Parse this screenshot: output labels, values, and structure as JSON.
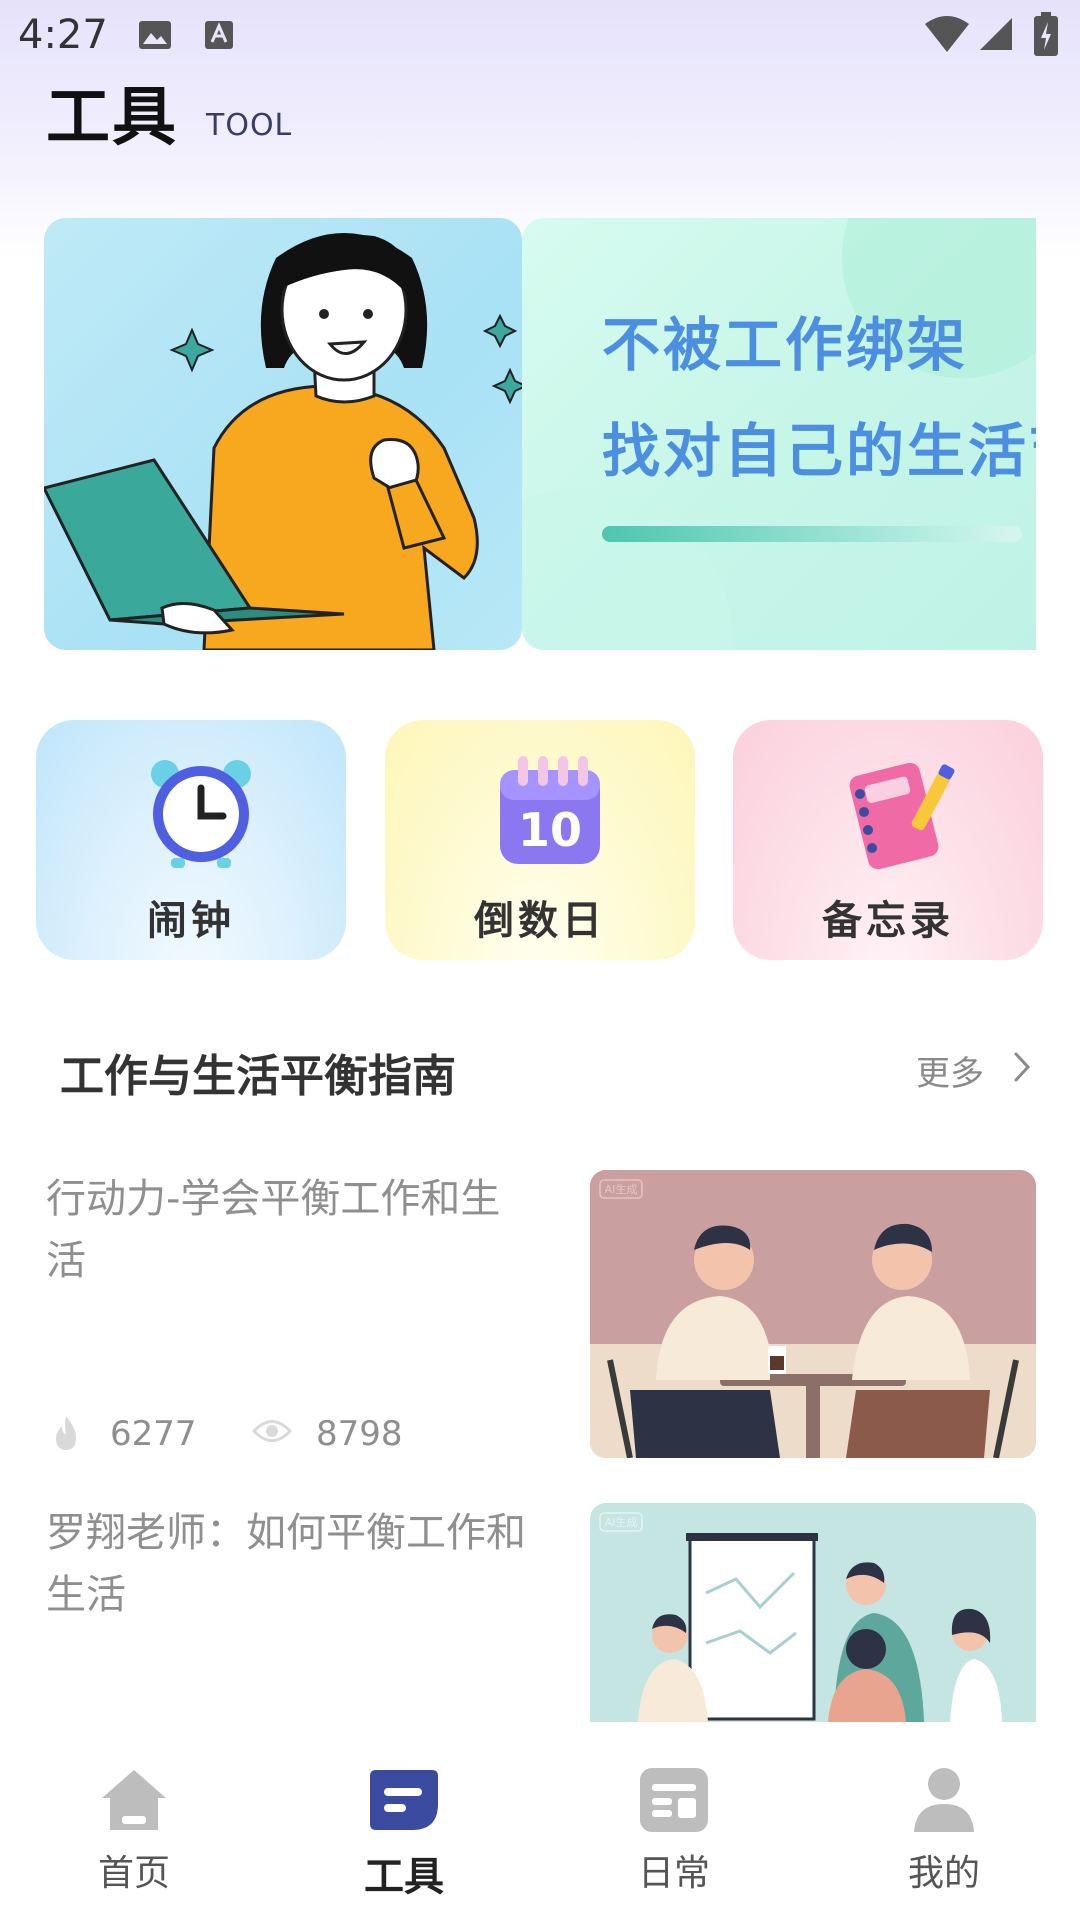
{
  "status_bar": {
    "time": "4:27"
  },
  "header": {
    "title": "工具",
    "subtitle": "TOOL"
  },
  "banner": {
    "line1": "不被工作绑架",
    "line2": "找对自己的生活节"
  },
  "tools": [
    {
      "label": "闹钟",
      "icon": "alarm-clock-icon"
    },
    {
      "label": "倒数日",
      "icon": "calendar-countdown-icon",
      "badge": "10"
    },
    {
      "label": "备忘录",
      "icon": "notebook-icon"
    }
  ],
  "section": {
    "title": "工作与生活平衡指南",
    "more": "更多"
  },
  "articles": [
    {
      "title": "行动力-学会平衡工作和生活",
      "likes": "6277",
      "views": "8798",
      "thumb_badge": "AI生成"
    },
    {
      "title": "罗翔老师：如何平衡工作和生活",
      "thumb_badge": "AI生成"
    }
  ],
  "nav": [
    {
      "label": "首页",
      "icon": "home-icon"
    },
    {
      "label": "工具",
      "icon": "tools-icon",
      "active": true
    },
    {
      "label": "日常",
      "icon": "daily-icon"
    },
    {
      "label": "我的",
      "icon": "profile-icon"
    }
  ],
  "colors": {
    "accent": "#3a4ba0",
    "banner_text": "#4c8fe0",
    "muted": "#8f8f8f"
  }
}
